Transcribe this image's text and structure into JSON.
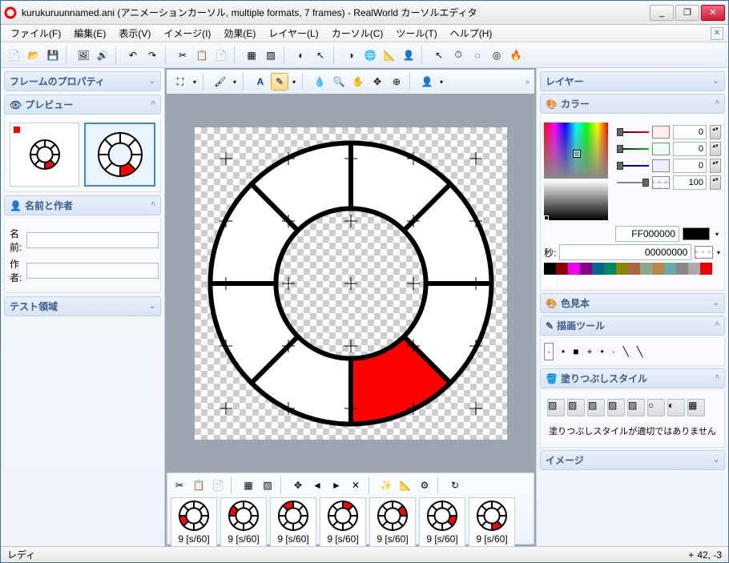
{
  "window": {
    "title": "kurukuruunnamed.ani (アニメーションカーソル, multiple formats, 7 frames) - RealWorld カーソルエディタ",
    "min": "_",
    "max": "❐",
    "close": "✕"
  },
  "menu": {
    "file": "ファイル(F)",
    "edit": "編集(E)",
    "view": "表示(V)",
    "image": "イメージ(I)",
    "effect": "効果(E)",
    "layer": "レイヤー(L)",
    "cursor": "カーソル(C)",
    "tool": "ツール(T)",
    "help": "ヘルプ(H)"
  },
  "panels": {
    "frameProps": "フレームのプロパティ",
    "preview": "プレビュー",
    "nameAuthor": "名前と作者",
    "testArea": "テスト領域",
    "layer": "レイヤー",
    "color": "カラー",
    "swatches": "色見本",
    "drawTool": "描画ツール",
    "fillStyle": "塗りつぶしスタイル",
    "image": "イメージ",
    "fillStyleMsg": "塗りつぶしスタイルが適切ではありません"
  },
  "form": {
    "nameLabel": "名前:",
    "nameValue": "",
    "authorLabel": "作者:",
    "authorValue": ""
  },
  "color": {
    "r": "0",
    "g": "0",
    "b": "0",
    "a": "100",
    "hex": "FF000000",
    "secLabel": "秒:",
    "secValue": "00000000"
  },
  "palette": [
    "#000",
    "#800",
    "#e0e",
    "#808",
    "#068",
    "#086",
    "#880",
    "#a64",
    "#8a8",
    "#b84",
    "#6aa",
    "#888",
    "#aaa",
    "#e00",
    "#fff"
  ],
  "frames": [
    {
      "label": "9 [s/60]",
      "slice": 5
    },
    {
      "label": "9 [s/60]",
      "slice": 6
    },
    {
      "label": "9 [s/60]",
      "slice": 7
    },
    {
      "label": "9 [s/60]",
      "slice": 0
    },
    {
      "label": "9 [s/60]",
      "slice": 1
    },
    {
      "label": "9 [s/60]",
      "slice": 2
    },
    {
      "label": "9 [s/60]",
      "slice": 3
    }
  ],
  "status": {
    "ready": "レディ",
    "coord": "42, -3"
  }
}
